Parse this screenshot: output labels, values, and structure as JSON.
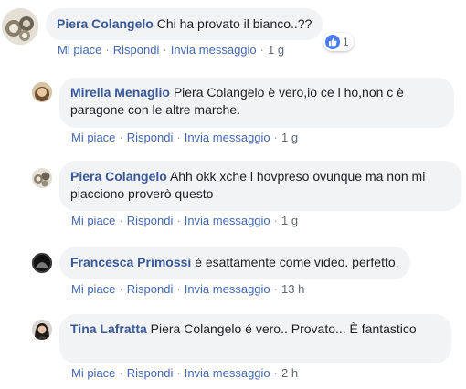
{
  "actions_labels": {
    "like": "Mi piace",
    "reply": "Rispondi",
    "message": "Invia messaggio",
    "dot": "·"
  },
  "comments": [
    {
      "author": "Piera Colangelo",
      "text": "Chi ha provato il bianco..??",
      "time": "1 g",
      "reactions": {
        "count": "1",
        "icon": "thumbs-up-icon",
        "color": "#4a7bf2"
      }
    },
    {
      "author": "Mirella Menaglio",
      "text": "Piera Colangelo è vero,io ce l ho,non c è paragone con le altre marche.",
      "time": "1 g"
    },
    {
      "author": "Piera Colangelo",
      "text": "Ahh okk xche l hovpreso ovunque ma non mi piacciono proverò questo",
      "time": "1 g"
    },
    {
      "author": "Francesca Primossi",
      "text": "è esattamente come video. perfetto.",
      "time": "13 h"
    },
    {
      "author": "Tina Lafratta",
      "text": "Piera Colangelo é vero.. Provato... È fantastico",
      "time": "2 h"
    }
  ],
  "colors": {
    "bubble_bg": "#f2f3f5",
    "author": "#385898",
    "link": "#4267b2",
    "meta": "#616770"
  }
}
